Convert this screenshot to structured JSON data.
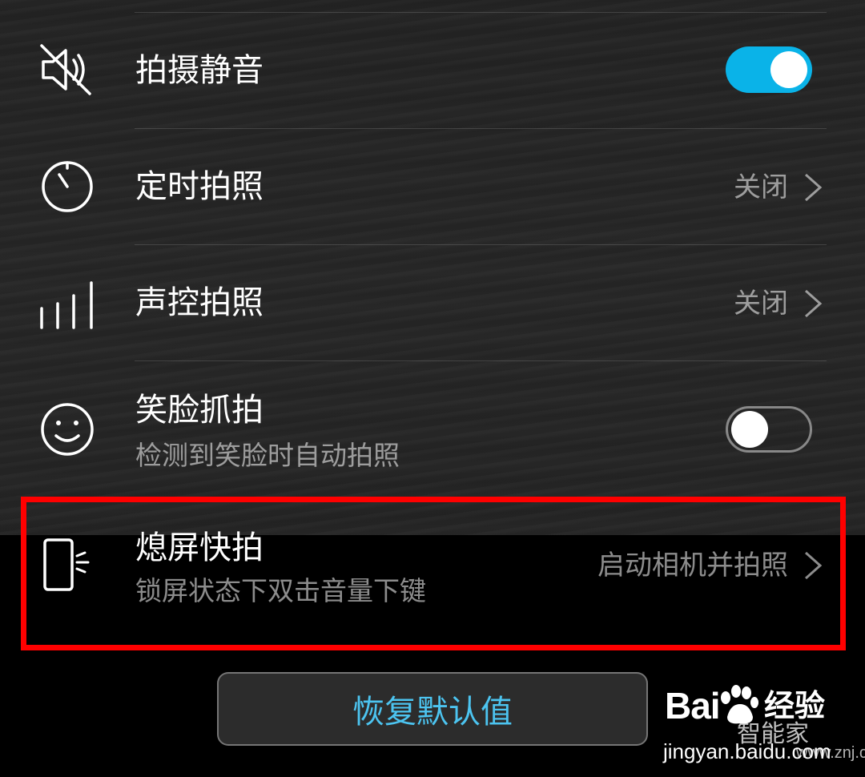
{
  "settings": {
    "items": [
      {
        "key": "silent",
        "title": "拍摄静音",
        "icon": "speaker-muted-icon",
        "control": "toggle",
        "toggle_on": true
      },
      {
        "key": "timer",
        "title": "定时拍照",
        "icon": "timer-icon",
        "value": "关闭",
        "control": "chevron"
      },
      {
        "key": "voice",
        "title": "声控拍照",
        "icon": "audio-bars-icon",
        "value": "关闭",
        "control": "chevron"
      },
      {
        "key": "smile",
        "title": "笑脸抓拍",
        "subtitle": "检测到笑脸时自动拍照",
        "icon": "smiley-face-icon",
        "control": "toggle",
        "toggle_on": false
      },
      {
        "key": "ultra",
        "title": "熄屏快拍",
        "subtitle": "锁屏状态下双击音量下键",
        "icon": "phone-volume-key-icon",
        "value": "启动相机并拍照",
        "control": "chevron",
        "highlighted": true
      }
    ]
  },
  "restore_button": {
    "label": "恢复默认值"
  },
  "watermark": {
    "brand_left": "Bai",
    "brand_right": "du",
    "product": "经验",
    "secondary": "智能家",
    "url": "jingyan.baidu.com",
    "url2": "www.znj.com"
  },
  "colors": {
    "accent": "#0ab3e8",
    "button_text": "#4cc4f0",
    "highlight": "#ff0000",
    "textured_bg": "#252525",
    "black_bg": "#000000"
  }
}
